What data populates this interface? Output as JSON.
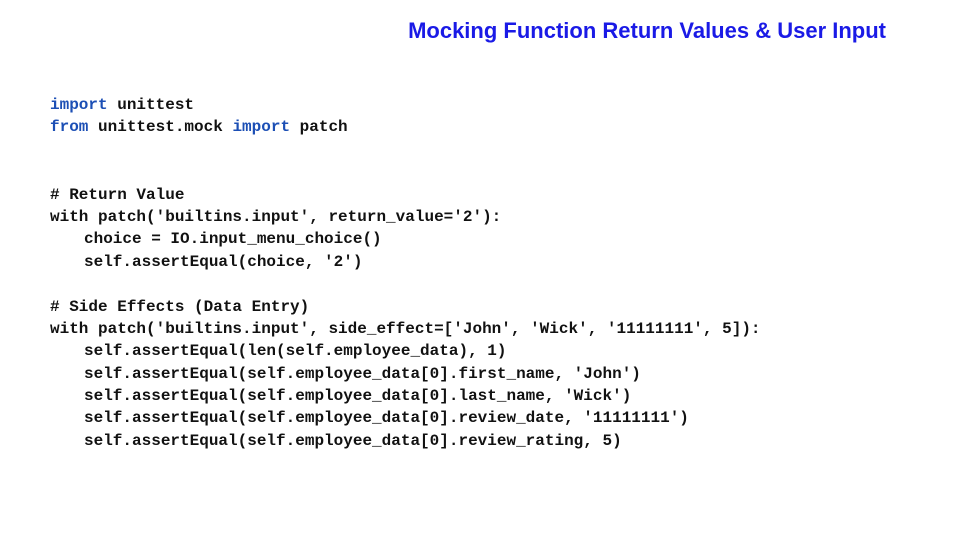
{
  "slide": {
    "title": "Mocking Function Return Values & User Input"
  },
  "code": {
    "imports": [
      {
        "kw1": "import",
        "rest1": " unittest"
      },
      {
        "kw1": "from",
        "mid": " unittest.mock ",
        "kw2": "import",
        "rest2": " patch"
      }
    ],
    "return_value_block": {
      "comment": "# Return Value",
      "with_line": "with patch('builtins.input', return_value='2'):",
      "body": [
        "choice = IO.input_menu_choice()",
        "self.assertEqual(choice, '2')"
      ]
    },
    "side_effects_block": {
      "comment": "# Side Effects (Data Entry)",
      "with_line": "with patch('builtins.input', side_effect=['John', 'Wick', '11111111', 5]):",
      "body": [
        "self.assertEqual(len(self.employee_data), 1)",
        "self.assertEqual(self.employee_data[0].first_name, 'John')",
        "self.assertEqual(self.employee_data[0].last_name, 'Wick')",
        "self.assertEqual(self.employee_data[0].review_date, '11111111')",
        "self.assertEqual(self.employee_data[0].review_rating, 5)"
      ]
    }
  },
  "colors": {
    "title": "#1a1ae6",
    "keyword": "#1c4fb5",
    "text": "#111111",
    "background": "#ffffff"
  }
}
